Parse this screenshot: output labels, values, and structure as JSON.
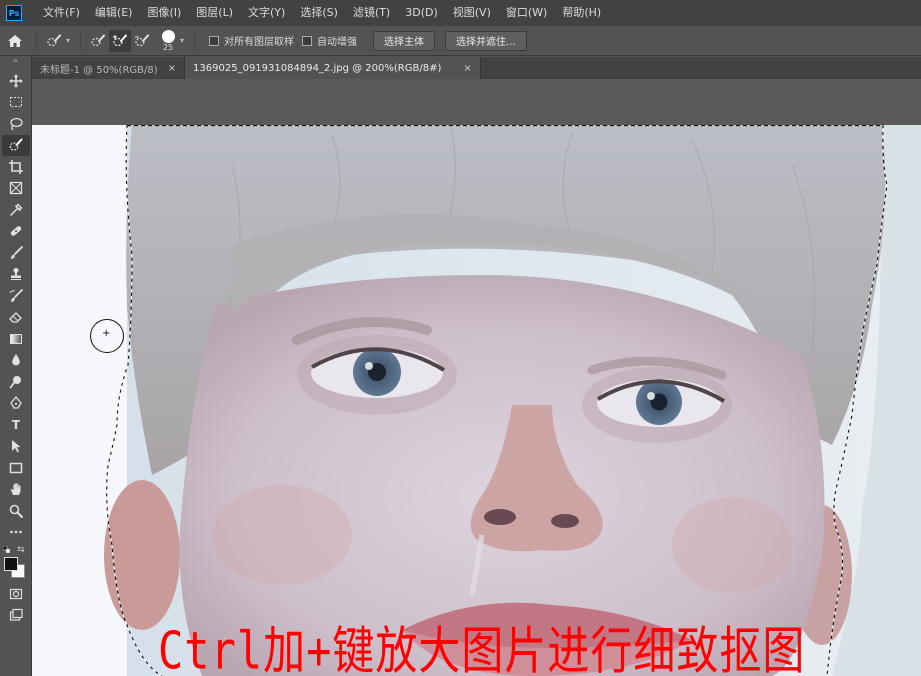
{
  "app": {
    "logo": "Ps"
  },
  "menu": [
    "文件(F)",
    "编辑(E)",
    "图像(I)",
    "图层(L)",
    "文字(Y)",
    "选择(S)",
    "滤镜(T)",
    "3D(D)",
    "视图(V)",
    "窗口(W)",
    "帮助(H)"
  ],
  "options": {
    "brush_size": "25",
    "sample_all_layers": "对所有图层取样",
    "auto_enhance": "自动增强",
    "select_subject": "选择主体",
    "select_and_mask": "选择并遮住..."
  },
  "tabs": [
    {
      "label": "未标题-1 @ 50%(RGB/8)",
      "close": "×"
    },
    {
      "label": "1369025_091931084894_2.jpg @ 200%(RGB/8#)",
      "close": "×"
    }
  ],
  "toolbar_grip": "»",
  "overlay_text": "Ctrl加+键放大图片进行细致抠图",
  "colors": {
    "foreground": "#111111",
    "background": "#ffffff",
    "overlay": "#ff0000"
  }
}
